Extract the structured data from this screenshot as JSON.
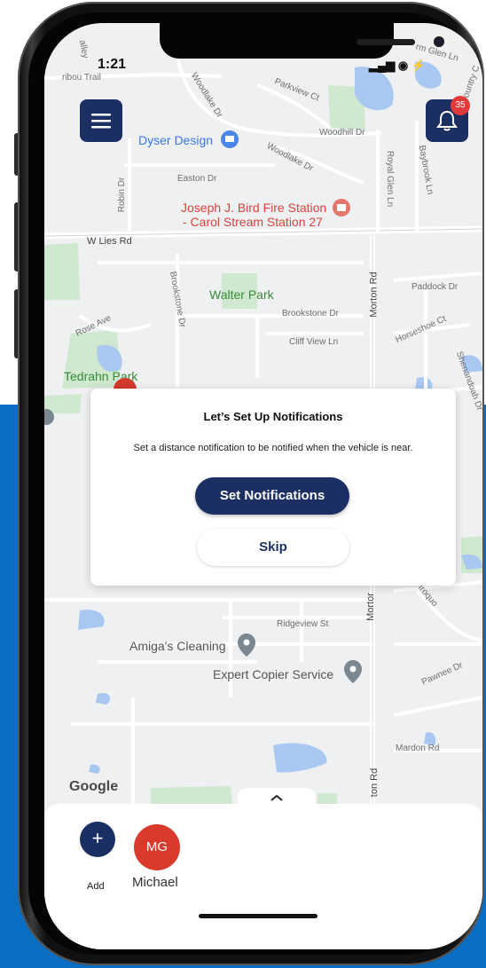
{
  "status_bar": {
    "time": "1:21",
    "signal_text": "▂▄▆ ◉ ⚡"
  },
  "header": {
    "menu_icon": "hamburger-menu-icon",
    "notification_icon": "bell-icon",
    "notification_count": "35"
  },
  "map": {
    "labels": {
      "caribou_trail": "ribou Trail",
      "valley": "alley",
      "parkview_ct": "Parkview Ct",
      "woodhill_dr": "Woodhill Dr",
      "royal_glen_ln": "Royal Glen Ln",
      "baybrook_ln": "Baybrook Ln",
      "woodlake_dr_1": "Woodlake Dr",
      "woodlake_dr_2": "Woodlake Dr",
      "easton_dr": "Easton Dr",
      "robin_dr": "Robin Dr",
      "w_lies_rd": "W Lies Rd",
      "brookstone_dr_1": "Brookstone Dr",
      "brookstone_dr_2": "Brookstone Dr",
      "morton_rd_1": "Morton Rd",
      "paddock_dr": "Paddock Dr",
      "horseshoe_ct": "Horseshoe Ct",
      "cliff_view_ln": "Cliff View Ln",
      "rose_ave": "Rose Ave",
      "shenandoah_dr": "Shenandoah Dr",
      "ridgeview_st": "Ridgeview St",
      "mortor": "Mortor",
      "iroquois": "Iroquo",
      "pawnee_dr": "Pawnee Dr",
      "mardon_rd": "Mardon Rd",
      "ton_rd": "ton Rd",
      "glen_ln": "rm Glen Ln",
      "country": "Country C"
    },
    "pois": {
      "dyser_design": "Dyser Design",
      "fire_station_line1": "Joseph J. Bird Fire Station",
      "fire_station_line2": "- Carol Stream Station 27",
      "walter_park": "Walter Park",
      "tedrahn_park": "Tedrahn Park",
      "amigas_cleaning": "Amiga's Cleaning",
      "expert_copier": "Expert Copier Service"
    },
    "attribution": "Google"
  },
  "modal": {
    "title": "Let’s Set Up Notifications",
    "body": "Set a distance notification to be notified when the vehicle is near.",
    "primary_label": "Set Notifications",
    "secondary_label": "Skip"
  },
  "sheet": {
    "handle_icon": "chevron-up-icon",
    "add_symbol": "+",
    "add_label": "Add",
    "avatar_initials": "MG",
    "avatar_name": "Michael"
  },
  "colors": {
    "navy": "#1c2f63",
    "accent_red": "#d93a2b",
    "background_blue": "#0a6fc2",
    "map_bg": "#eef0f2"
  }
}
